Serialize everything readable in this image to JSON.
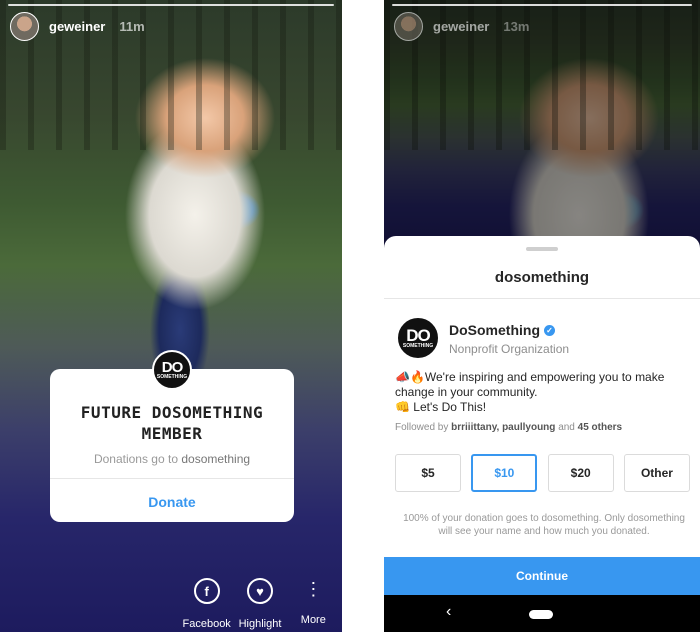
{
  "left_story": {
    "username": "geweiner",
    "time": "11m",
    "sticker": {
      "logo_text": "DO",
      "logo_sub": "SOMETHING",
      "title_line1": "FUTURE DOSOMETHING",
      "title_line2": "MEMBER",
      "sub_prefix": "Donations go to",
      "sub_org": "dosomething",
      "donate_label": "Donate"
    },
    "actions": [
      {
        "label": "Facebook",
        "icon": "facebook-icon",
        "glyph": "f"
      },
      {
        "label": "Highlight",
        "icon": "heart-icon",
        "glyph": "♥"
      },
      {
        "label": "More",
        "icon": "more-icon",
        "glyph": "⋮"
      }
    ]
  },
  "right_story": {
    "username": "geweiner",
    "time": "13m",
    "sheet": {
      "title": "dosomething",
      "org_name": "DoSomething",
      "org_category": "Nonprofit Organization",
      "description_line1": "📣🔥We're inspiring and empowering you to make change in your community.",
      "description_line2": "👊 Let's Do This!",
      "followed_prefix": "Followed by",
      "followed_names": "brriiittany, paullyoung",
      "followed_and": "and",
      "followed_others": "45 others",
      "amounts": [
        "$5",
        "$10",
        "$20",
        "Other"
      ],
      "selected_amount": "$10",
      "note": "100% of your donation goes to dosomething. Only dosomething will see your name and how much you donated.",
      "continue_label": "Continue"
    },
    "nav": {
      "back_glyph": "‹"
    }
  },
  "colors": {
    "accent": "#3897f0",
    "story_bg": "#1d1b5e"
  }
}
